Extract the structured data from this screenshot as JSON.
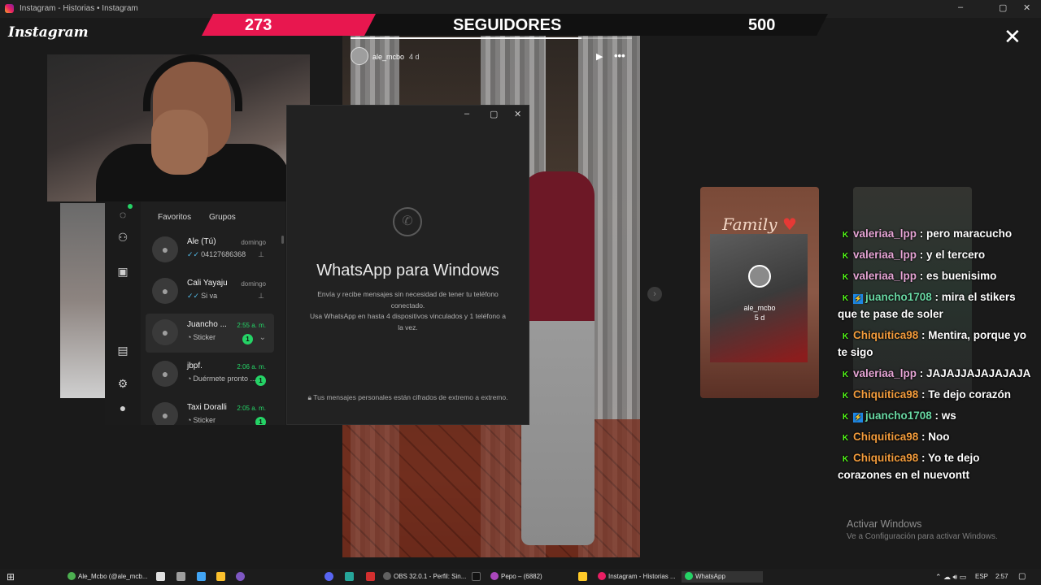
{
  "window": {
    "title": "Instagram - Historias • Instagram",
    "controls": [
      "–",
      "▢",
      "✕"
    ]
  },
  "instagram": {
    "logo": "Instagram",
    "close": "✕",
    "story": {
      "user": "ale_mcbo",
      "age": "4 d",
      "progress": 0.82
    },
    "side_card": {
      "title": "Family",
      "user": "ale_mcbo",
      "age": "5 d"
    }
  },
  "followers": {
    "current": "273",
    "label": "SEGUIDORES",
    "goal": "500",
    "fill_fraction": 0.546
  },
  "whatsapp": {
    "tabs": [
      "Favoritos",
      "Grupos"
    ],
    "chats": [
      {
        "name": "Ale (Tú)",
        "time": "domingo",
        "preview": "04127686368",
        "read": true,
        "pinned": true,
        "unread": ""
      },
      {
        "name": "Cali Yayaju",
        "time": "domingo",
        "preview": "Si va",
        "read": true,
        "pinned": true,
        "unread": ""
      },
      {
        "name": "Juancho ...",
        "time": "2:55 a. m.",
        "preview": "Sticker",
        "read": false,
        "pinned": false,
        "unread": "1"
      },
      {
        "name": "jbpf.",
        "time": "2:06 a. m.",
        "preview": "Duérmete pronto ...",
        "read": false,
        "pinned": false,
        "unread": "1"
      },
      {
        "name": "Taxi  Doralli",
        "time": "2:05 a. m.",
        "preview": "Sticker",
        "read": false,
        "pinned": false,
        "unread": "1"
      }
    ],
    "main": {
      "title": "WhatsApp para Windows",
      "desc1": "Envía y recibe mensajes sin necesidad de tener tu teléfono conectado.",
      "desc2": "Usa WhatsApp en hasta 4 dispositivos vinculados y 1 teléfono a la vez.",
      "encryption": "Tus mensajes personales están cifrados de extremo a extremo."
    }
  },
  "stream_chat": [
    {
      "user": "valeriaa_lpp",
      "color": "#e7a6d6",
      "text": " : pero maracucho",
      "boost": false
    },
    {
      "user": "valeriaa_lpp",
      "color": "#e7a6d6",
      "text": " : y el tercero",
      "boost": false
    },
    {
      "user": "valeriaa_lpp",
      "color": "#e7a6d6",
      "text": " : es buenisimo",
      "boost": false
    },
    {
      "user": "juancho1708",
      "color": "#69d9a4",
      "text": " : mira el stikers que te pase de soler",
      "boost": true
    },
    {
      "user": "Chiquitica98",
      "color": "#f39c3c",
      "text": " : Mentira, porque yo te sigo",
      "boost": false
    },
    {
      "user": "valeriaa_lpp",
      "color": "#e7a6d6",
      "text": " : JAJAJJAJAJAJAJA",
      "boost": false
    },
    {
      "user": "Chiquitica98",
      "color": "#f39c3c",
      "text": " : Te dejo corazón",
      "boost": false
    },
    {
      "user": "juancho1708",
      "color": "#69d9a4",
      "text": " : ws",
      "boost": true
    },
    {
      "user": "Chiquitica98",
      "color": "#f39c3c",
      "text": " : Noo",
      "boost": false
    },
    {
      "user": "Chiquitica98",
      "color": "#f39c3c",
      "text": " : Yo te dejo corazones en el nuevontt",
      "boost": false
    }
  ],
  "activation": {
    "title": "Activar Windows",
    "subtitle": "Ve a Configuración para activar Windows."
  },
  "taskbar": {
    "items": [
      "Ale_Mcbo (@ale_mcb...",
      "OBS 32.0.1 - Perfil: Sin...",
      "Pepo – (6882)",
      "Instagram - Historias ...",
      "WhatsApp"
    ],
    "language": "ESP",
    "clock": "2:57"
  }
}
